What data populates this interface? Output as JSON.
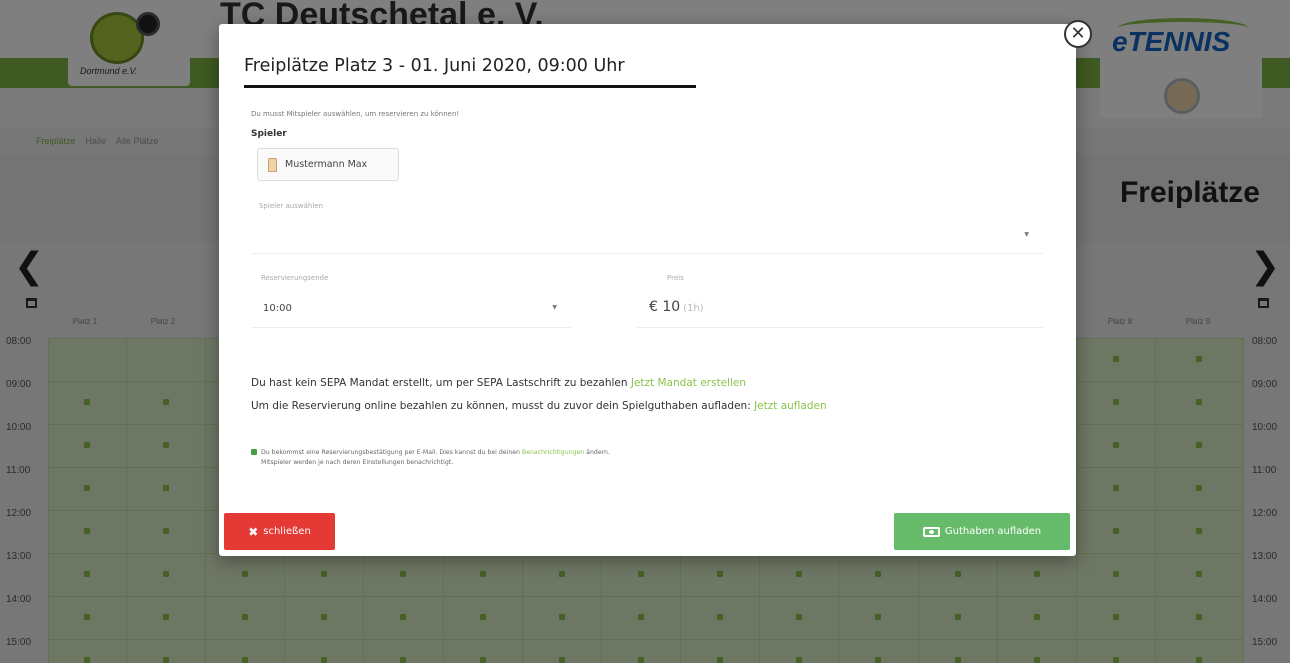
{
  "background": {
    "club_name": "TC Deutschetal e. V.",
    "club_logo_text": "Dortmund e.V.",
    "brand_logo_text": "eTENNIS",
    "subnav": [
      "Freiplätze",
      "Halle",
      "Alle Plätze"
    ],
    "page_title": "Freiplätze",
    "courts_left": [
      "Platz 1",
      "Platz 2"
    ],
    "courts_right": [
      "Platz 8",
      "Platz 9"
    ],
    "times": [
      "08:00",
      "09:00",
      "10:00",
      "11:00",
      "12:00",
      "13:00",
      "14:00",
      "15:00"
    ]
  },
  "modal": {
    "title": "Freiplätze Platz 3 - 01. Juni 2020, 09:00 Uhr",
    "hint": "Du musst Mitspieler auswählen, um reservieren zu können!",
    "players_label": "Spieler",
    "player_chip": "Mustermann Max",
    "select_players_placeholder": "Spieler auswählen",
    "reservation_end_label": "Reservierungsende",
    "reservation_end_value": "10:00",
    "price_label": "Preis",
    "price_value": "€ 10",
    "price_duration": "(1h)",
    "sepa_message": "Du hast kein SEPA Mandat erstellt, um per SEPA Lastschrift zu bezahlen",
    "sepa_link": "Jetzt Mandat erstellen",
    "credit_message": "Um die Reservierung online bezahlen zu können, musst du zuvor dein Spielguthaben aufladen:",
    "credit_link": "Jetzt aufladen",
    "info_line1_pre": "Du bekommst eine Reservierungsbestätigung per E-Mail. Dies kannst du bei deinen",
    "info_link": "Benachrichtigungen",
    "info_line1_post": "ändern.",
    "info_line2": "Mitspieler werden je nach deren Einstellungen benachrichtigt.",
    "close_button": "schließen",
    "topup_button": "Guthaben aufladen"
  },
  "colors": {
    "accent_green": "#8bc34a",
    "danger_red": "#e53935",
    "success_green": "#66bb6a"
  }
}
